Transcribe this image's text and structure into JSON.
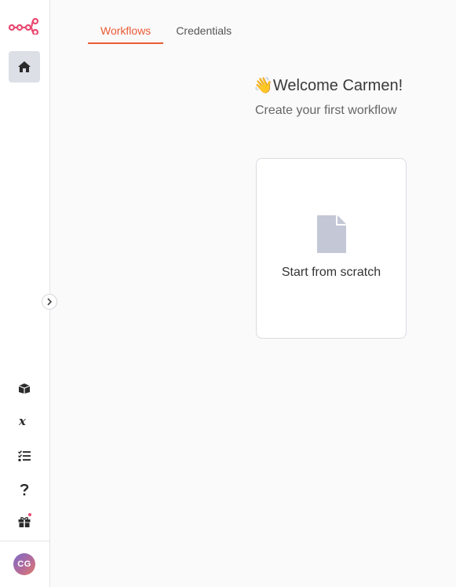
{
  "sidebar": {
    "logo_icon": "n8n-logo-icon",
    "home_icon": "home-icon",
    "bottom_items": [
      {
        "icon": "templates-icon"
      },
      {
        "icon": "variables-icon"
      },
      {
        "icon": "executions-icon"
      },
      {
        "icon": "help-icon"
      },
      {
        "icon": "whats-new-gift-icon",
        "has_notification_dot": true
      }
    ],
    "user_initials": "CG",
    "colors": {
      "active_bg": "#dcdfe6",
      "logo": "#ea4b71",
      "notification": "#ea4b71"
    }
  },
  "tabs": [
    {
      "label": "Workflows",
      "active": true
    },
    {
      "label": "Credentials",
      "active": false
    }
  ],
  "main": {
    "welcome_emoji": "👋",
    "welcome_title": "Welcome Carmen!",
    "subtitle": "Create your first workflow",
    "card": {
      "label": "Start from scratch",
      "icon": "file-icon"
    }
  },
  "colors": {
    "accent": "#ea5b34",
    "background": "#fafafb"
  }
}
